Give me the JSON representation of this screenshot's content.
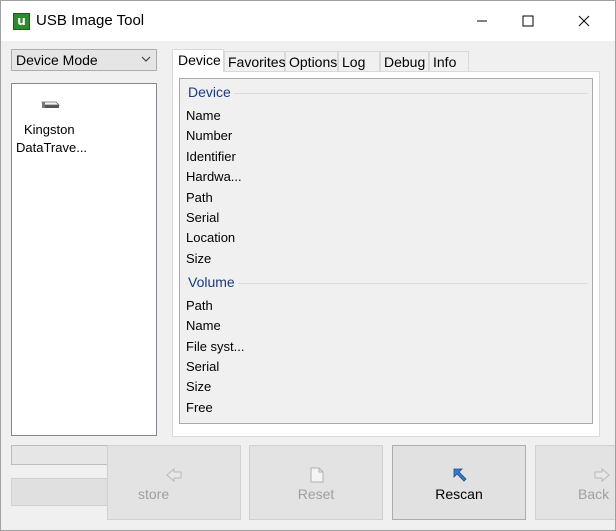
{
  "window": {
    "title": "USB Image Tool",
    "icon_letter": "u",
    "controls": [
      "minimize-icon",
      "maximize-icon",
      "close-icon"
    ]
  },
  "mode_select": {
    "value": "Device Mode"
  },
  "device_list": {
    "items": [
      {
        "line1": "Kingston",
        "line2": "DataTrave...",
        "icon": "usb-drive-icon"
      }
    ]
  },
  "tabs": [
    {
      "label": "Device",
      "active": true
    },
    {
      "label": "Favorites",
      "active": false
    },
    {
      "label": "Options",
      "active": false
    },
    {
      "label": "Log",
      "active": false
    },
    {
      "label": "Debug",
      "active": false
    },
    {
      "label": "Info",
      "active": false
    }
  ],
  "device_group": {
    "title": "Device",
    "fields": [
      "Name",
      "Number",
      "Identifier",
      "Hardwa...",
      "Path",
      "Serial",
      "Location",
      "Size"
    ]
  },
  "volume_group": {
    "title": "Volume",
    "fields": [
      "Path",
      "Name",
      "File syst...",
      "Serial",
      "Size",
      "Free"
    ]
  },
  "buttons": {
    "restore": {
      "label": "store",
      "enabled": false,
      "icon": "restore-arrow-icon"
    },
    "reset": {
      "label": "Reset",
      "enabled": false,
      "icon": "document-icon"
    },
    "rescan": {
      "label": "Rescan",
      "enabled": true,
      "icon": "rescan-arrow-icon"
    },
    "backup": {
      "label": "Back",
      "enabled": false,
      "icon": "backup-arrow-icon"
    }
  },
  "colors": {
    "group_title": "#1a3a7a",
    "app_icon": "#2f8a2f",
    "rescan_icon": "#3a78c8"
  }
}
